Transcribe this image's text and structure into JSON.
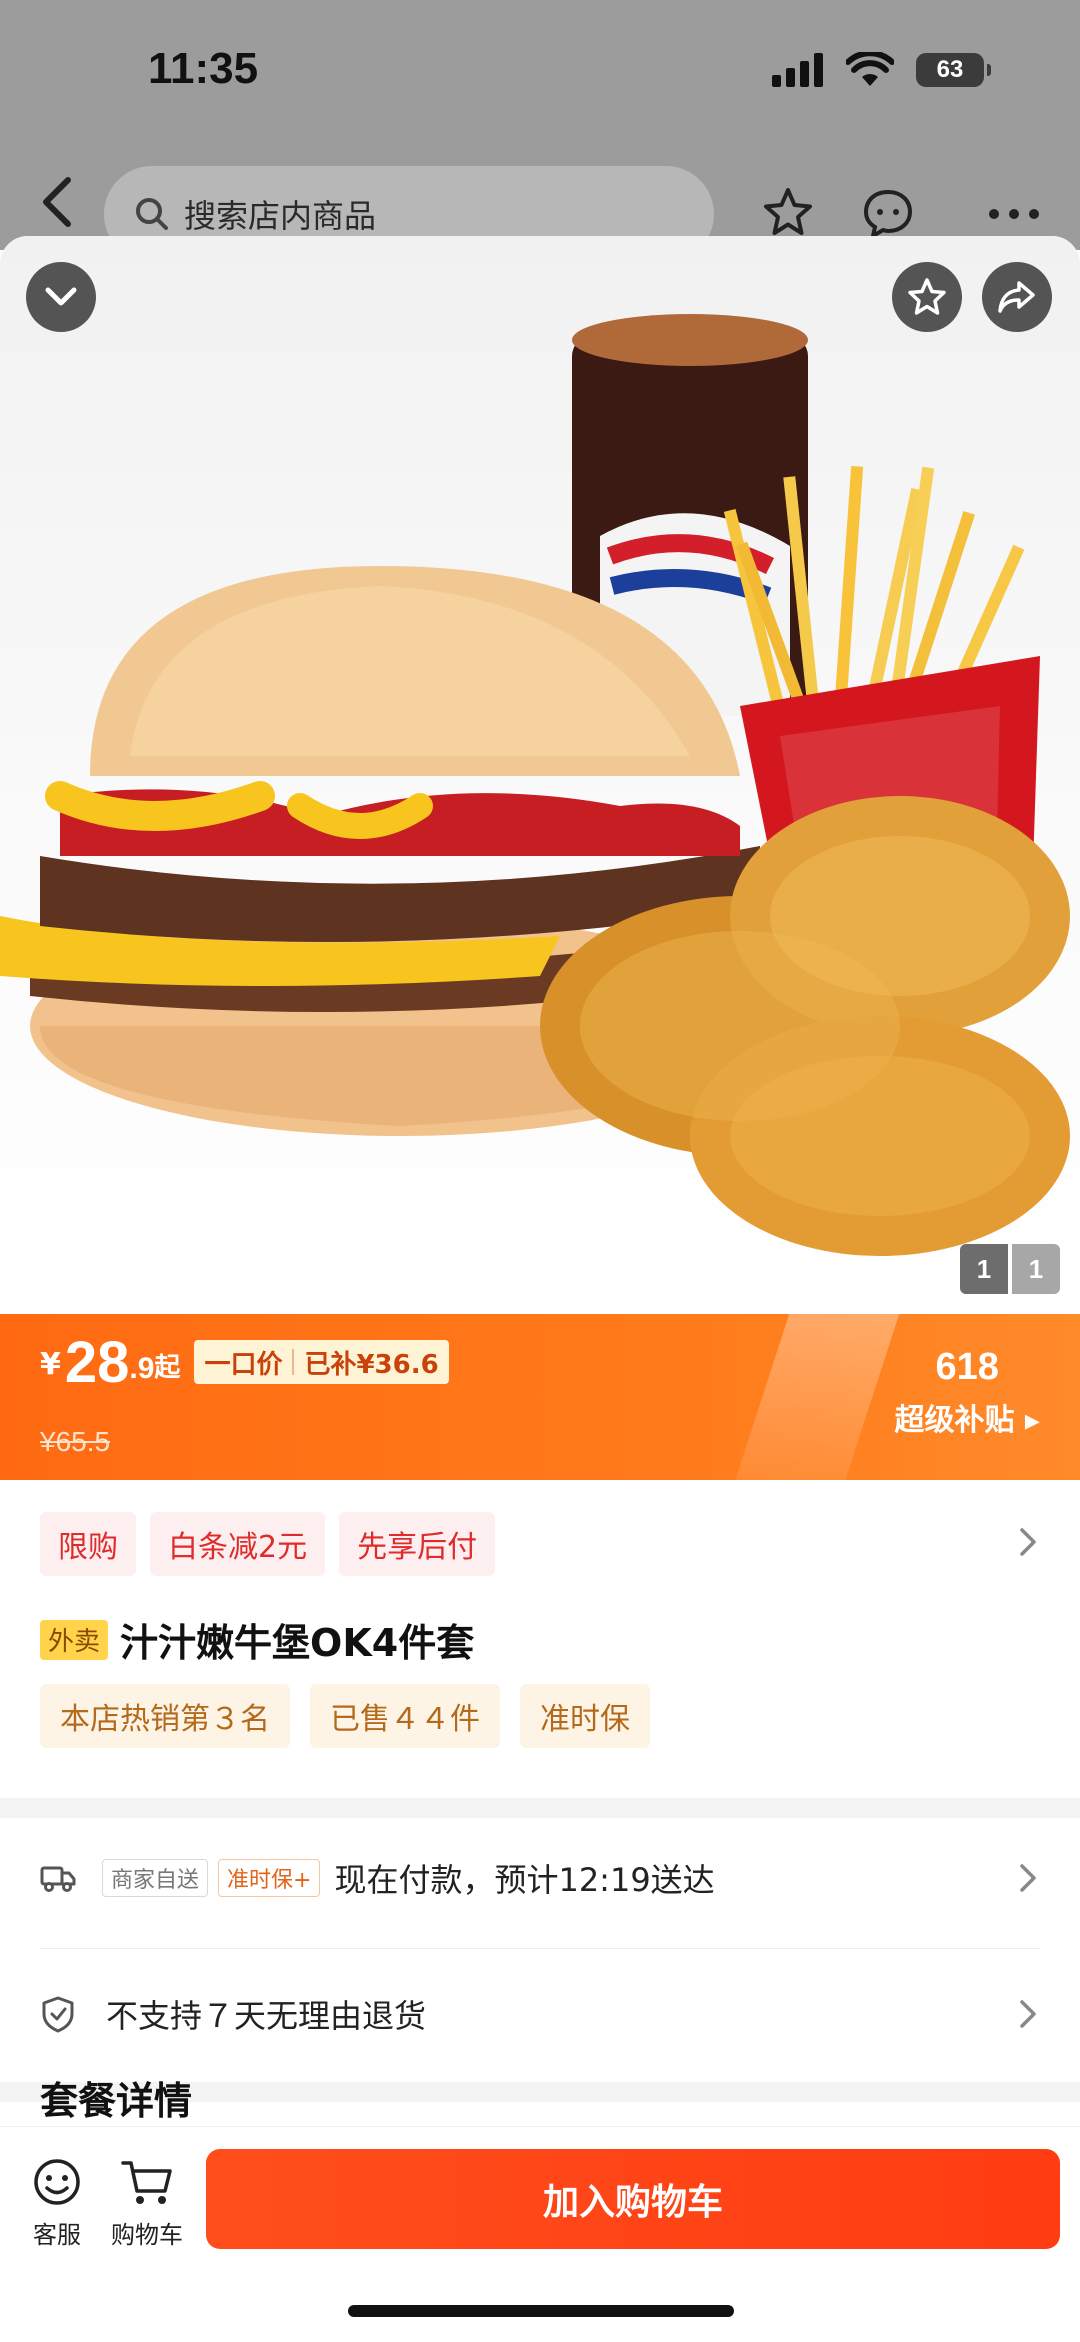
{
  "status_bar": {
    "time": "11:35",
    "battery": "63"
  },
  "store_nav": {
    "search_placeholder": "搜索店内商品"
  },
  "gallery": {
    "current": "1",
    "total": "1"
  },
  "price": {
    "currency": "¥",
    "integer": "28",
    "decimal": ".9",
    "suffix": "起",
    "tag_left": "一口价",
    "tag_right": "已补¥36.6",
    "original": "¥65.5",
    "promo_number": "618",
    "promo_text": "超级补贴 ▸"
  },
  "promo_tags": [
    "限购",
    "白条减2元",
    "先享后付"
  ],
  "product": {
    "delivery_badge": "外卖",
    "title": "汁汁嫩牛堡OK4件套",
    "info_tags": [
      "本店热销第３名",
      "已售４４件",
      "准时保"
    ]
  },
  "shipping": {
    "tag_merchant": "商家自送",
    "tag_ontime": "准时保+",
    "text": "现在付款，预计12:19送达"
  },
  "returns": {
    "text": "不支持７天无理由退货"
  },
  "section": {
    "title": "套餐详情"
  },
  "bottom_bar": {
    "service_label": "客服",
    "cart_label": "购物车",
    "add_to_cart": "加入购物车"
  },
  "colors": {
    "accent_orange": "#ff6a12",
    "cta_red": "#ff4e1c",
    "promo_red": "#e02b2b",
    "gold": "#b46a1b"
  }
}
